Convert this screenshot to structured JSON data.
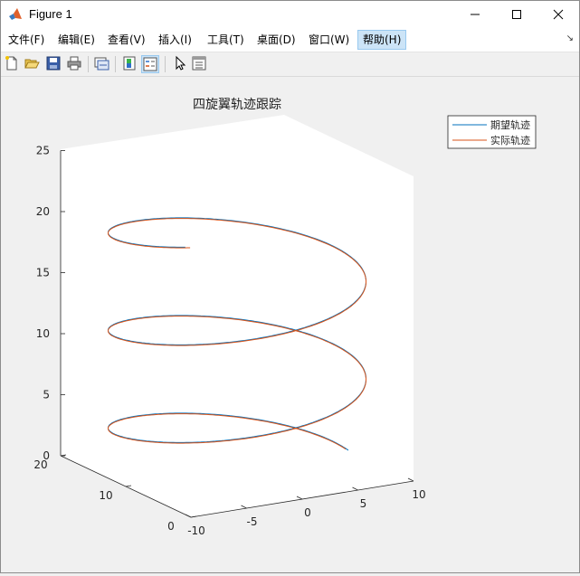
{
  "window": {
    "title": "Figure 1",
    "controls": {
      "minimize": "minimize",
      "maximize": "maximize",
      "close": "close"
    }
  },
  "menu": {
    "items": [
      "文件(F)",
      "编辑(E)",
      "查看(V)",
      "插入(I)",
      "工具(T)",
      "桌面(D)",
      "窗口(W)",
      "帮助(H)"
    ],
    "active": "帮助(H)"
  },
  "toolbar": {
    "buttons": [
      "new-figure-icon",
      "open-file-icon",
      "save-icon",
      "print-icon",
      "link-plot-icon",
      "colorbar-icon",
      "legend-icon",
      "pointer-icon",
      "property-inspector-icon"
    ]
  },
  "chart_data": {
    "type": "line3d",
    "title": "四旋翼轨迹跟踪",
    "xlabel": "",
    "ylabel": "",
    "zlabel": "",
    "xlim": [
      -10,
      10
    ],
    "ylim": [
      0,
      20
    ],
    "zlim": [
      0,
      25
    ],
    "xticks": [
      "-10",
      "-5",
      "0",
      "5",
      "10"
    ],
    "yticks": [
      "0",
      "10",
      "20"
    ],
    "zticks": [
      "0",
      "5",
      "10",
      "15",
      "20",
      "25"
    ],
    "grid": false,
    "legend_location": "top-right",
    "series": [
      {
        "name": "期望轨迹",
        "color": "#0072bd",
        "radius": 10,
        "center": [
          0,
          10
        ],
        "z_per_turn": 8,
        "turns": 2.6,
        "phase_offset": 0
      },
      {
        "name": "实际轨迹",
        "color": "#d95319",
        "radius": 10,
        "center": [
          0,
          10
        ],
        "z_per_turn": 8,
        "turns": 2.6,
        "phase_offset": 0.04
      }
    ]
  }
}
